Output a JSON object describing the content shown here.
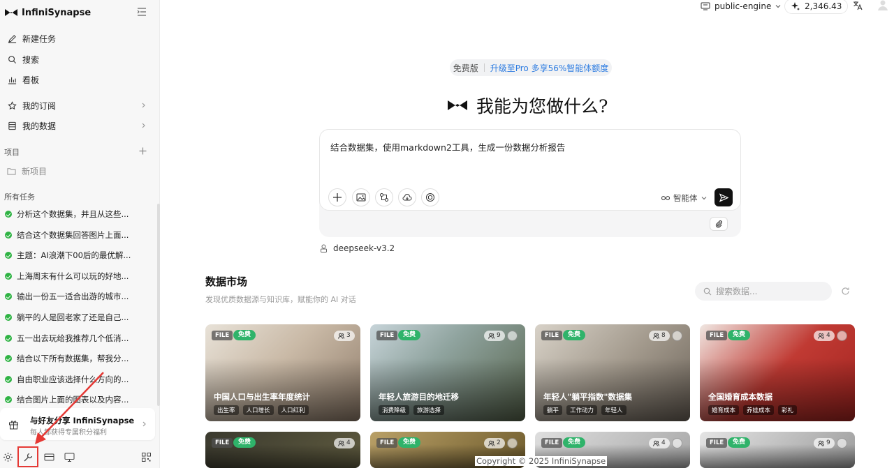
{
  "brand": {
    "name": "InfiniSynapse"
  },
  "nav": {
    "new_task": "新建任务",
    "search": "搜索",
    "dashboard": "看板",
    "subscriptions": "我的订阅",
    "my_data": "我的数据"
  },
  "projects": {
    "label": "项目",
    "new_project": "新项目"
  },
  "tasks": {
    "label": "所有任务",
    "items": [
      "分析这个数据集，并且从这些...",
      "结合这个数据集回答图片上面...",
      "主题：AI浪潮下00后的最优解...",
      "上海周末有什么可以玩的好地...",
      "输出一份五一适合出游的城市...",
      "躺平的人是回老家了还是自己...",
      "五一出去玩给我推荐几个低消...",
      "结合以下所有数据集，帮我分...",
      "自由职业应该选择什么方向的...",
      "结合图片上面的图表以及内容..."
    ]
  },
  "share": {
    "title": "与好友分享 InfiniSynapse",
    "subtitle": "每人都获得专属积分福利"
  },
  "topbar": {
    "engine": "public-engine",
    "credits": "2,346.43"
  },
  "plan": {
    "free": "免费版",
    "upgrade": "升级至Pro 多享56%智能体额度"
  },
  "hero": {
    "title": "我能为您做什么?"
  },
  "prompt": {
    "text": "结合数据集，使用markdown2工具，生成一份数据分析报告",
    "agent": "智能体"
  },
  "model": {
    "name": "deepseek-v3.2"
  },
  "market": {
    "title": "数据市场",
    "subtitle": "发现优质数据源与知识库，赋能你的 AI 对话",
    "search_placeholder": "搜索数据..."
  },
  "cards": [
    {
      "file": "FILE",
      "free": "免费",
      "users": "3",
      "title": "中国人口与出生率年度统计",
      "tags": [
        "出生率",
        "人口增长",
        "人口红利"
      ]
    },
    {
      "file": "FILE",
      "free": "免费",
      "users": "9",
      "title": "年轻人旅游目的地迁移",
      "tags": [
        "消费降级",
        "旅游选择"
      ]
    },
    {
      "file": "FILE",
      "free": "免费",
      "users": "8",
      "title": "年轻人\"躺平指数\"数据集",
      "tags": [
        "躺平",
        "工作动力",
        "年轻人"
      ]
    },
    {
      "file": "FILE",
      "free": "免费",
      "users": "4",
      "title": "全国婚育成本数据",
      "tags": [
        "婚育成本",
        "养娃成本",
        "彩礼"
      ]
    },
    {
      "file": "FILE",
      "free": "免费",
      "users": "4"
    },
    {
      "file": "FILE",
      "free": "免费",
      "users": "2"
    },
    {
      "file": "FILE",
      "free": "免费",
      "users": "4"
    },
    {
      "file": "FILE",
      "free": "免费",
      "users": "9"
    }
  ],
  "footer": {
    "copyright": "Copyright © 2025 InfiniSynapse"
  }
}
